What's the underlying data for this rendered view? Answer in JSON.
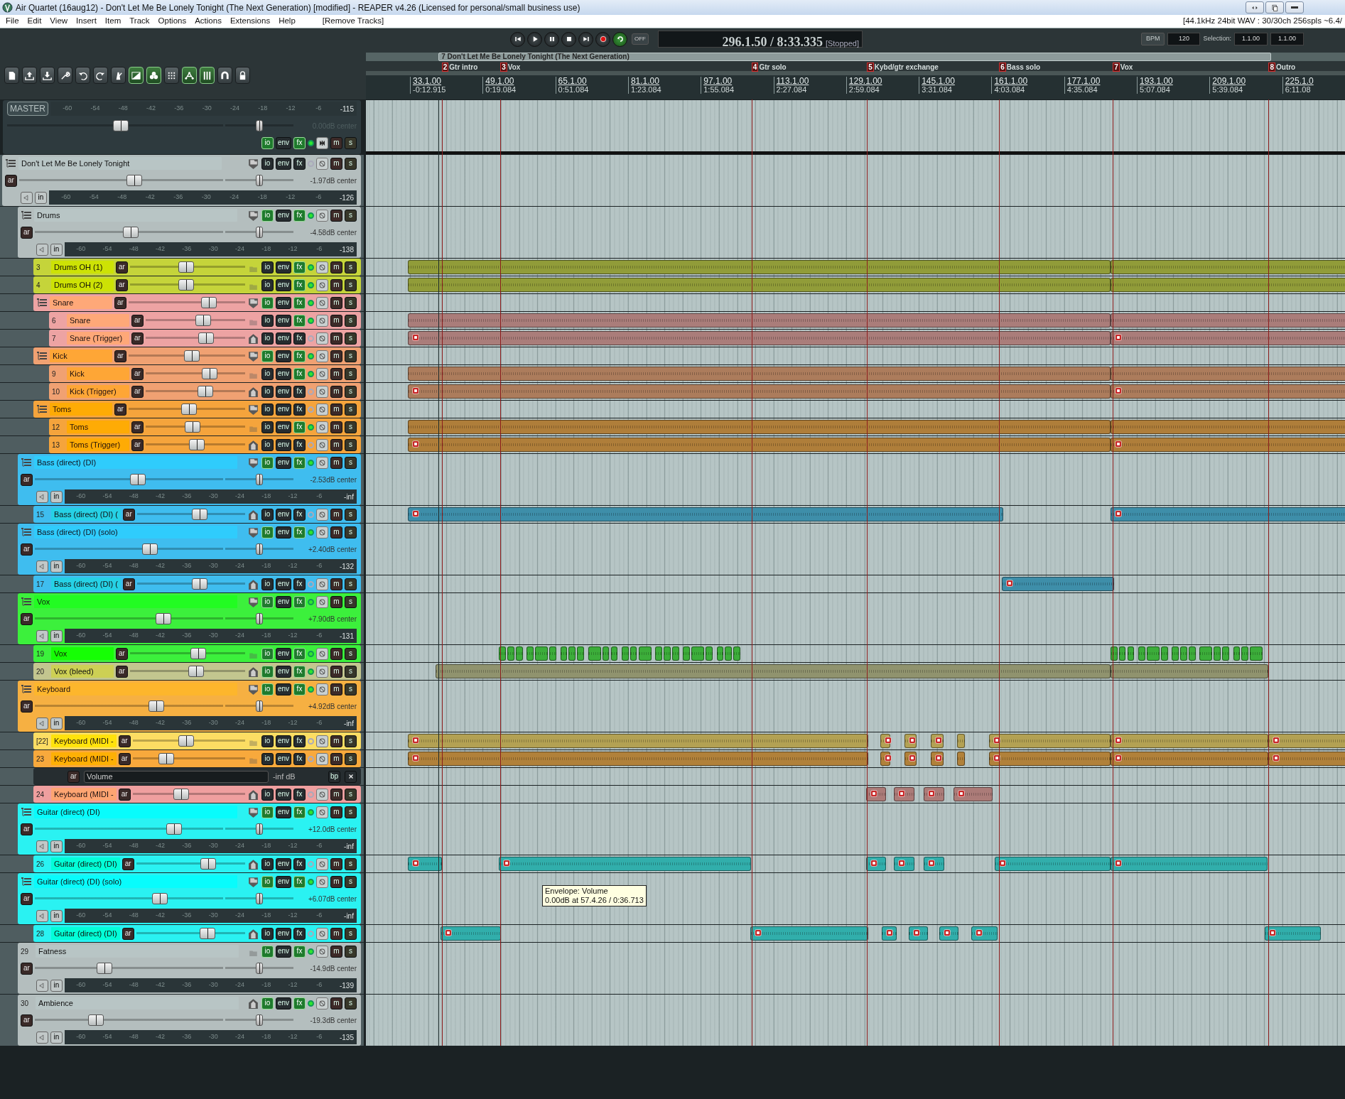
{
  "window": {
    "title": "Air Quartet (16aug12) - Don't Let Me Be Lonely Tonight (The Next Generation) [modified] - REAPER v4.26 (Licensed for personal/small business use)"
  },
  "menu": [
    "File",
    "Edit",
    "View",
    "Insert",
    "Item",
    "Track",
    "Options",
    "Actions",
    "Extensions",
    "Help",
    "[Remove Tracks]"
  ],
  "status": "[44.1kHz 24bit WAV : 30/30ch 256spls ~6.4/",
  "toolbar": [
    {
      "kind": "new",
      "on": false
    },
    {
      "kind": "open",
      "on": false
    },
    {
      "kind": "save",
      "on": false
    },
    {
      "kind": "wrench",
      "on": false
    },
    {
      "kind": "undo",
      "on": false
    },
    {
      "kind": "redo",
      "on": false
    },
    {
      "kind": "metronome",
      "on": false
    },
    {
      "kind": "crossfade",
      "on": true
    },
    {
      "kind": "grouping",
      "on": true
    },
    {
      "kind": "grid",
      "on": false
    },
    {
      "kind": "envlink",
      "on": true
    },
    {
      "kind": "bars",
      "on": true
    },
    {
      "kind": "magnet",
      "on": false
    },
    {
      "kind": "lock",
      "on": false
    }
  ],
  "transport": {
    "buttons": [
      {
        "kind": "start",
        "on": false
      },
      {
        "kind": "play",
        "on": false
      },
      {
        "kind": "pause",
        "on": false
      },
      {
        "kind": "stop",
        "on": false
      },
      {
        "kind": "end",
        "on": false
      },
      {
        "kind": "record",
        "on": false
      },
      {
        "kind": "repeat",
        "on": true
      }
    ],
    "off_label": "OFF",
    "position": "296.1.50 / 8:33.335",
    "state": "[Stopped]",
    "bpm_label": "BPM",
    "bpm": "120",
    "selection_label": "Selection:",
    "selection_start": "1.1.00",
    "selection_end": "1.1.00"
  },
  "region": "7 Don't Let Me Be Lonely Tonight (The Next Generation)",
  "markers": [
    {
      "number": "2",
      "label": "Gtr intro"
    },
    {
      "number": "3",
      "label": "Vox"
    },
    {
      "number": "4",
      "label": "Gtr solo"
    },
    {
      "number": "5",
      "label": "Kybd/gtr exchange"
    },
    {
      "number": "6",
      "label": "Bass solo"
    },
    {
      "number": "7",
      "label": "Vox"
    },
    {
      "number": "8",
      "label": "Outro"
    }
  ],
  "ruler": [
    {
      "measure": "33.1.00",
      "time": "-0:12.915"
    },
    {
      "measure": "49.1.00",
      "time": "0:19.084"
    },
    {
      "measure": "65.1.00",
      "time": "0:51.084"
    },
    {
      "measure": "81.1.00",
      "time": "1:23.084"
    },
    {
      "measure": "97.1.00",
      "time": "1:55.084"
    },
    {
      "measure": "113.1.00",
      "time": "2:27.084"
    },
    {
      "measure": "129.1.00",
      "time": "2:59.084"
    },
    {
      "measure": "145.1.00",
      "time": "3:31.084"
    },
    {
      "measure": "161.1.00",
      "time": "4:03.084"
    },
    {
      "measure": "177.1.00",
      "time": "4:35.084"
    },
    {
      "measure": "193.1.00",
      "time": "5:07.084"
    },
    {
      "measure": "209.1.00",
      "time": "5:39.084"
    },
    {
      "measure": "225.1.0",
      "time": "6:11.08"
    }
  ],
  "master": {
    "label": "MASTER",
    "meter_scale": [
      "-60",
      "-54",
      "-48",
      "-42",
      "-36",
      "-30",
      "-24",
      "-18",
      "-12",
      "-6"
    ],
    "meter_reading": "-115",
    "level": 0.53,
    "pan": {
      "level": 0.5
    },
    "reading": "0.00dB center",
    "io": "io",
    "env": "env",
    "fx": "fx",
    "m": "m",
    "s": "s",
    "io_on": true,
    "fx_on": true,
    "active": true
  },
  "tracks": [
    {
      "kind": "tall",
      "name": "Don't Let Me Be Lonely Tonight",
      "color": "#b4bebe",
      "level": 0.57,
      "pan": {
        "level": 0.5
      },
      "reading": "-1.97dB center",
      "meter_scale": [
        "-60",
        "-54",
        "-48",
        "-42",
        "-36",
        "-30",
        "-24",
        "-18",
        "-12",
        "-6"
      ],
      "meter_reading": "-126",
      "ar": "ar",
      "in": "in",
      "io": "io",
      "env": "env",
      "fx": "fx",
      "m": "m",
      "s": "s",
      "io_on": false,
      "fx_on": false,
      "active": false,
      "children": [
        {
          "kind": "tall",
          "name": "Drums",
          "color": "#b4bebe",
          "level": 0.51,
          "pan": {
            "level": 0.5
          },
          "reading": "-4.58dB center",
          "meter_scale": [
            "-60",
            "-54",
            "-48",
            "-42",
            "-36",
            "-30",
            "-24",
            "-18",
            "-12",
            "-6"
          ],
          "meter_reading": "-138",
          "ar": "ar",
          "in": "in",
          "io": "io",
          "env": "env",
          "fx": "fx",
          "m": "m",
          "s": "s",
          "io_on": true,
          "fx_on": true,
          "active": true,
          "children": [
            {
              "kind": "compact",
              "number": "3",
              "name": "Drums OH (1)",
              "color": "#c5d43a",
              "level": 0.49,
              "ar": "ar",
              "io": "io",
              "env": "env",
              "fx": "fx",
              "m": "m",
              "s": "s",
              "io_on": false,
              "fx_on": true,
              "active": true
            },
            {
              "kind": "compact",
              "number": "4",
              "name": "Drums OH (2)",
              "color": "#c5d43a",
              "level": 0.49,
              "ar": "ar",
              "io": "io",
              "env": "env",
              "fx": "fx",
              "m": "m",
              "s": "s",
              "io_on": false,
              "fx_on": true,
              "active": true
            },
            {
              "kind": "compact",
              "name": "Snare",
              "color": "#eda3a3",
              "level": 0.72,
              "ar": "ar",
              "io": "io",
              "env": "env",
              "fx": "fx",
              "m": "m",
              "s": "s",
              "io_on": true,
              "fx_on": true,
              "active": true,
              "children": [
                {
                  "kind": "compact",
                  "number": "6",
                  "name": "Snare",
                  "color": "#eda3a3",
                  "level": 0.59,
                  "ar": "ar",
                  "io": "io",
                  "env": "env",
                  "fx": "fx",
                  "m": "m",
                  "s": "s",
                  "io_on": false,
                  "fx_on": true,
                  "active": true
                },
                {
                  "kind": "compact",
                  "number": "7",
                  "name": "Snare (Trigger)",
                  "color": "#eda3a3",
                  "level": 0.63,
                  "ar": "ar",
                  "io": "io",
                  "env": "env",
                  "fx": "fx",
                  "m": "m",
                  "s": "s",
                  "io_on": false,
                  "fx_on": false,
                  "active": false
                }
              ]
            },
            {
              "kind": "compact",
              "name": "Kick",
              "color": "#f0a172",
              "level": 0.55,
              "ar": "ar",
              "io": "io",
              "env": "env",
              "fx": "fx",
              "m": "m",
              "s": "s",
              "io_on": true,
              "fx_on": true,
              "active": true,
              "children": [
                {
                  "kind": "compact",
                  "number": "9",
                  "name": "Kick",
                  "color": "#f0a172",
                  "level": 0.67,
                  "ar": "ar",
                  "io": "io",
                  "env": "env",
                  "fx": "fx",
                  "m": "m",
                  "s": "s",
                  "io_on": false,
                  "fx_on": true,
                  "active": true
                },
                {
                  "kind": "compact",
                  "number": "10",
                  "name": "Kick (Trigger)",
                  "color": "#f0a172",
                  "level": 0.62,
                  "ar": "ar",
                  "io": "io",
                  "env": "env",
                  "fx": "fx",
                  "m": "m",
                  "s": "s",
                  "io_on": false,
                  "fx_on": false,
                  "active": false
                }
              ]
            },
            {
              "kind": "compact",
              "name": "Toms",
              "color": "#f5a43c",
              "level": 0.52,
              "ar": "ar",
              "io": "io",
              "env": "env",
              "fx": "fx",
              "m": "m",
              "s": "s",
              "io_on": false,
              "fx_on": false,
              "active": false,
              "children": [
                {
                  "kind": "compact",
                  "number": "12",
                  "name": "Toms",
                  "color": "#f5a43c",
                  "level": 0.47,
                  "ar": "ar",
                  "io": "io",
                  "env": "env",
                  "fx": "fx",
                  "m": "m",
                  "s": "s",
                  "io_on": false,
                  "fx_on": true,
                  "active": true
                },
                {
                  "kind": "compact",
                  "number": "13",
                  "name": "Toms (Trigger)",
                  "color": "#f5a43c",
                  "level": 0.52,
                  "ar": "ar",
                  "io": "io",
                  "env": "env",
                  "fx": "fx",
                  "m": "m",
                  "s": "s",
                  "io_on": false,
                  "fx_on": false,
                  "active": false
                }
              ]
            }
          ]
        },
        {
          "kind": "tall",
          "name": "Bass (direct) (DI)",
          "color": "#3fbdef",
          "level": 0.55,
          "pan": {
            "level": 0.5
          },
          "reading": "-2.53dB center",
          "meter_scale": [
            "-60",
            "-54",
            "-48",
            "-42",
            "-36",
            "-30",
            "-24",
            "-18",
            "-12",
            "-6"
          ],
          "meter_reading": "-inf",
          "ar": "ar",
          "in": "in",
          "io": "io",
          "env": "env",
          "fx": "fx",
          "m": "m",
          "s": "s",
          "io_on": true,
          "fx_on": true,
          "active": true,
          "children": [
            {
              "kind": "compact",
              "number": "15",
              "name": "Bass (direct) (DI) (",
              "color": "#3fbdef",
              "level": 0.59,
              "ar": "ar",
              "io": "io",
              "env": "env",
              "fx": "fx",
              "m": "m",
              "s": "s",
              "io_on": false,
              "fx_on": false,
              "active": false
            }
          ]
        },
        {
          "kind": "tall",
          "name": "Bass (direct) (DI) (solo)",
          "color": "#3fbdef",
          "level": 0.62,
          "pan": {
            "level": 0.5
          },
          "reading": "+2.40dB center",
          "meter_scale": [
            "-60",
            "-54",
            "-48",
            "-42",
            "-36",
            "-30",
            "-24",
            "-18",
            "-12",
            "-6"
          ],
          "meter_reading": "-132",
          "ar": "ar",
          "in": "in",
          "io": "io",
          "env": "env",
          "fx": "fx",
          "m": "m",
          "s": "s",
          "io_on": true,
          "fx_on": true,
          "active": true,
          "children": [
            {
              "kind": "compact",
              "number": "17",
              "name": "Bass (direct) (DI) (",
              "color": "#3fbdef",
              "level": 0.59,
              "ar": "ar",
              "io": "io",
              "env": "env",
              "fx": "fx",
              "m": "m",
              "s": "s",
              "io_on": false,
              "fx_on": false,
              "active": false
            }
          ]
        },
        {
          "kind": "tall",
          "name": "Vox",
          "color": "#3cf03c",
          "level": 0.7,
          "pan": {
            "level": 0.5
          },
          "reading": "+7.90dB center",
          "meter_scale": [
            "-60",
            "-54",
            "-48",
            "-42",
            "-36",
            "-30",
            "-24",
            "-18",
            "-12",
            "-6"
          ],
          "meter_reading": "-131",
          "ar": "ar",
          "in": "in",
          "io": "io",
          "env": "env",
          "fx": "fx",
          "m": "m",
          "s": "s",
          "io_on": true,
          "fx_on": true,
          "active": true,
          "children": [
            {
              "kind": "compact",
              "number": "19",
              "name": "Vox",
              "color": "#3cf03c",
              "level": 0.61,
              "ar": "ar",
              "io": "io",
              "env": "env",
              "fx": "fx",
              "m": "m",
              "s": "s",
              "io_on": true,
              "fx_on": true,
              "active": true
            },
            {
              "kind": "compact",
              "number": "20",
              "name": "Vox  (bleed)",
              "color": "#c3c68f",
              "level": 0.59,
              "ar": "ar",
              "io": "io",
              "env": "env",
              "fx": "fx",
              "m": "m",
              "s": "s",
              "io_on": true,
              "fx_on": true,
              "active": true
            }
          ]
        },
        {
          "kind": "tall",
          "name": "Keyboard",
          "color": "#f6b042",
          "level": 0.66,
          "pan": {
            "level": 0.5
          },
          "reading": "+4.92dB center",
          "meter_scale": [
            "-60",
            "-54",
            "-48",
            "-42",
            "-36",
            "-30",
            "-24",
            "-18",
            "-12",
            "-6"
          ],
          "meter_reading": "-inf",
          "ar": "ar",
          "in": "in",
          "io": "io",
          "env": "env",
          "fx": "fx",
          "m": "m",
          "s": "s",
          "io_on": true,
          "fx_on": true,
          "active": true,
          "children": [
            {
              "kind": "compact",
              "number": "[22]",
              "name": "Keyboard (MIDI -",
              "color": "#fcdd63",
              "level": 0.47,
              "ar": "ar",
              "io": "io",
              "env": "env",
              "fx": "fx",
              "m": "m",
              "s": "s",
              "io_on": false,
              "fx_on": false,
              "active": false
            },
            {
              "kind": "compact",
              "number": "23",
              "name": "Keyboard (MIDI -",
              "color": "#f8a93c",
              "level": 0.27,
              "ar": "ar",
              "io": "io",
              "env": "env",
              "fx": "fx",
              "m": "m",
              "s": "s",
              "io_on": false,
              "fx_on": false,
              "active": false
            },
            {
              "kind": "envelope",
              "ar": "ar",
              "name": "Volume",
              "reading": "-inf dB",
              "bp": "bp"
            },
            {
              "kind": "compact",
              "number": "24",
              "name": "Keyboard (MIDI -",
              "color": "#ef9f9f",
              "level": 0.42,
              "ar": "ar",
              "io": "io",
              "env": "env",
              "fx": "fx",
              "m": "m",
              "s": "s",
              "io_on": false,
              "fx_on": false,
              "active": false
            }
          ]
        },
        {
          "kind": "tall",
          "name": "Guitar (direct) (DI)",
          "color": "#2af2f2",
          "level": 0.76,
          "pan": {
            "level": 0.5
          },
          "reading": "+12.0dB center",
          "meter_scale": [
            "-60",
            "-54",
            "-48",
            "-42",
            "-36",
            "-30",
            "-24",
            "-18",
            "-12",
            "-6"
          ],
          "meter_reading": "-inf",
          "ar": "ar",
          "in": "in",
          "io": "io",
          "env": "env",
          "fx": "fx",
          "m": "m",
          "s": "s",
          "io_on": true,
          "fx_on": true,
          "active": true,
          "children": [
            {
              "kind": "compact",
              "number": "26",
              "name": "Guitar (direct) (DI)",
              "color": "#2af2f2",
              "level": 0.69,
              "ar": "ar",
              "io": "io",
              "env": "env",
              "fx": "fx",
              "m": "m",
              "s": "s",
              "io_on": false,
              "fx_on": false,
              "active": false
            }
          ]
        },
        {
          "kind": "tall",
          "name": "Guitar (direct) (DI) (solo)",
          "color": "#2af2f2",
          "level": 0.68,
          "pan": {
            "level": 0.5
          },
          "reading": "+6.07dB center",
          "meter_scale": [
            "-60",
            "-54",
            "-48",
            "-42",
            "-36",
            "-30",
            "-24",
            "-18",
            "-12",
            "-6"
          ],
          "meter_reading": "-inf",
          "ar": "ar",
          "in": "in",
          "io": "io",
          "env": "env",
          "fx": "fx",
          "m": "m",
          "s": "s",
          "io_on": true,
          "fx_on": true,
          "active": true,
          "children": [
            {
              "kind": "compact",
              "number": "28",
              "name": "Guitar (direct) (DI)",
              "color": "#2af2f2",
              "level": 0.68,
              "ar": "ar",
              "io": "io",
              "env": "env",
              "fx": "fx",
              "m": "m",
              "s": "s",
              "io_on": false,
              "fx_on": false,
              "active": false
            }
          ]
        },
        {
          "kind": "tall",
          "number": "29",
          "name": "Fatness",
          "color": "#b4bebe",
          "level": 0.36,
          "pan": {
            "level": 0.5
          },
          "reading": "-14.9dB center",
          "meter_scale": [
            "-60",
            "-54",
            "-48",
            "-42",
            "-36",
            "-30",
            "-24",
            "-18",
            "-12",
            "-6"
          ],
          "meter_reading": "-139",
          "ar": "ar",
          "in": "in",
          "io": "io",
          "env": "env",
          "fx": "fx",
          "m": "m",
          "s": "s",
          "io_on": true,
          "fx_on": true,
          "active": true
        },
        {
          "kind": "tall",
          "number": "30",
          "name": "Ambience",
          "color": "#b4bebe",
          "level": 0.31,
          "pan": {
            "level": 0.5
          },
          "reading": "-19.3dB center",
          "meter_scale": [
            "-60",
            "-54",
            "-48",
            "-42",
            "-36",
            "-30",
            "-24",
            "-18",
            "-12",
            "-6"
          ],
          "meter_reading": "-135",
          "ar": "ar",
          "in": "in",
          "io": "io",
          "env": "env",
          "fx": "fx",
          "m": "m",
          "s": "s",
          "io_on": true,
          "fx_on": true,
          "active": true
        }
      ]
    }
  ],
  "tooltip": [
    "Envelope: Volume",
    "0.00dB at 57.4.26 / 0:36.713"
  ]
}
